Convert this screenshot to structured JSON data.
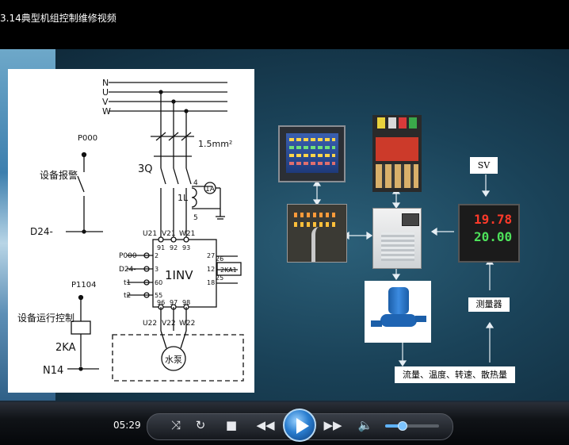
{
  "window": {
    "title": "3.14典型机组控制维修视频"
  },
  "schematic": {
    "phases": [
      "N",
      "U",
      "V",
      "W"
    ],
    "wire_size": "1.5mm²",
    "breaker": "3Q",
    "ct": "1L",
    "ammeter": "1A",
    "terminal_4": "4",
    "terminal_5": "5",
    "inv_top_labels": [
      "U21",
      "V21",
      "W21"
    ],
    "inv_top_pins": [
      "91",
      "92",
      "93"
    ],
    "inverter": "1INV",
    "left_signals": [
      "P000",
      "D24-",
      "t1",
      "t2"
    ],
    "left_pins": [
      "2",
      "3",
      "60",
      "55"
    ],
    "right_pins": [
      "27",
      "12",
      "18"
    ],
    "relay_pins": [
      "26",
      "25"
    ],
    "relay": "2KA1",
    "inv_bottom_pins": [
      "96",
      "97",
      "98"
    ],
    "inv_bottom_labels": [
      "U22",
      "V22",
      "W22"
    ],
    "pump": "水泵",
    "p000": "P000",
    "alarm": "设备报警",
    "d24": "D24-",
    "p1104": "P1104",
    "run_control": "设备运行控制",
    "relay_2ka": "2KA",
    "n14": "N14"
  },
  "diagram": {
    "sv_label": "SV",
    "controller_pv": "19.78",
    "controller_sv": "20.00",
    "sensor_label": "测量器",
    "measure_label": "流量、温度、转速、散热量"
  },
  "player": {
    "time": "05:29",
    "volume": 0.32,
    "buttons": {
      "shuffle": "shuffle-icon",
      "repeat": "repeat-icon",
      "stop": "stop-icon",
      "previous": "previous-icon",
      "play": "play-icon",
      "next": "next-icon",
      "volume": "volume-icon"
    }
  }
}
